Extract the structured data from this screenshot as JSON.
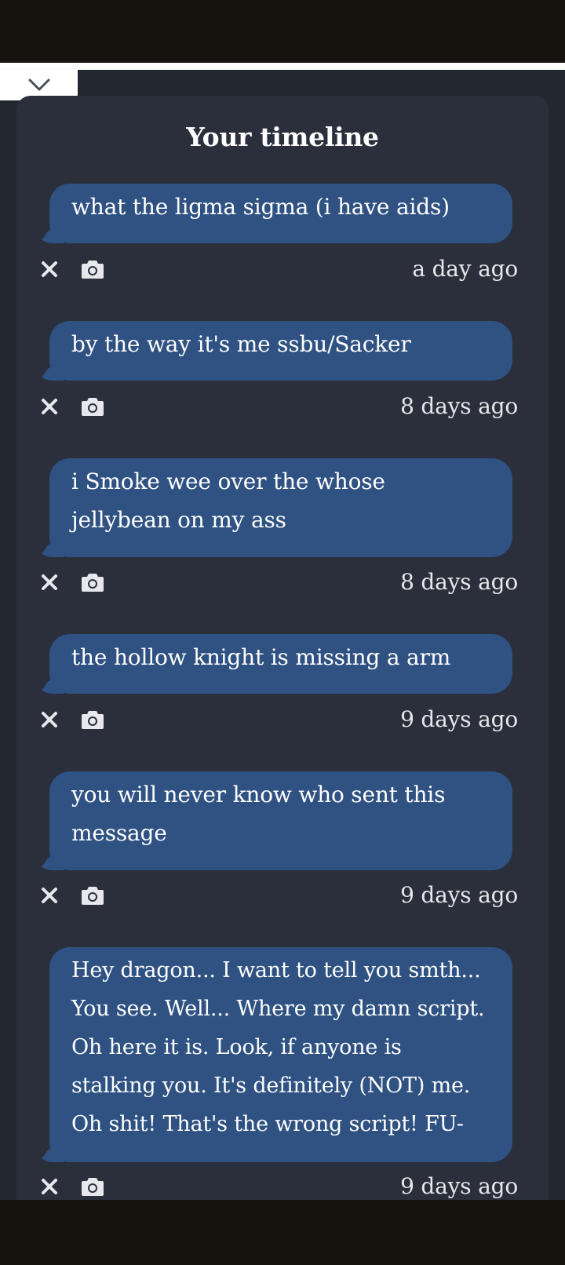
{
  "timeline": {
    "title": "Your timeline"
  },
  "icons": {
    "collapse": "chevron-down-icon",
    "delete": "close-icon",
    "screenshot": "camera-icon"
  },
  "colors": {
    "bubble": "#2f5283",
    "card": "#2a2f3b",
    "background": "#232830",
    "system_bar": "#15130d"
  },
  "messages": [
    {
      "text": "what the ligma sigma (i have aids)",
      "time": "a day ago"
    },
    {
      "text": "by the way it's me ssbu/Sacker",
      "time": "8 days ago"
    },
    {
      "text": "i Smoke wee over the whose jellybean on my ass",
      "time": "8 days ago"
    },
    {
      "text": "the hollow knight is missing a arm",
      "time": "9 days ago"
    },
    {
      "text": "you will never know who sent this message",
      "time": "9 days ago"
    },
    {
      "text": "Hey dragon... I want to tell you smth... You see. Well... Where my damn script. Oh here it is. Look, if anyone is stalking you. It's definitely (NOT) me. Oh shit! That's the wrong script! FU-",
      "time": "9 days ago"
    }
  ]
}
